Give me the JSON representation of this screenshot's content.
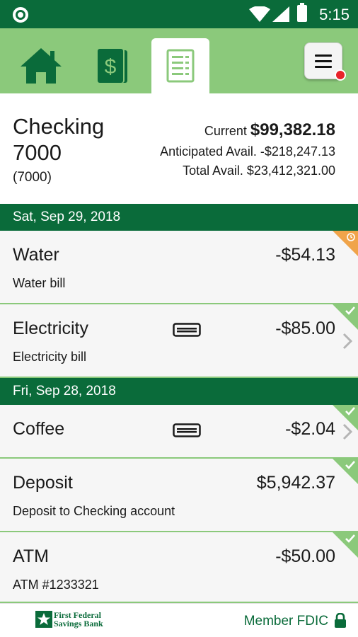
{
  "status_bar": {
    "time": "5:15"
  },
  "nav": {
    "tabs": [
      {
        "name": "home",
        "icon": "home-icon"
      },
      {
        "name": "accounts",
        "icon": "dollar-icon"
      },
      {
        "name": "register",
        "icon": "register-icon",
        "active": true
      }
    ],
    "menu_icon": "hamburger-icon"
  },
  "account": {
    "name": "Checking 7000",
    "number": "(7000)",
    "current_label": "Current",
    "current_amount": "$99,382.18",
    "anticipated_label": "Anticipated Avail.",
    "anticipated_amount": "-$218,247.13",
    "total_label": "Total Avail.",
    "total_amount": "$23,412,321.00"
  },
  "groups": [
    {
      "date": "Sat, Sep 29, 2018",
      "transactions": [
        {
          "title": "Water",
          "description": "Water bill",
          "amount": "-$54.13",
          "status": "pending"
        },
        {
          "title": "Electricity",
          "description": "Electricity bill",
          "amount": "-$85.00",
          "status": "cleared",
          "card": true
        }
      ]
    },
    {
      "date": "Fri, Sep 28, 2018",
      "transactions": [
        {
          "title": "Coffee",
          "description": "",
          "amount": "-$2.04",
          "status": "cleared",
          "card": true
        },
        {
          "title": "Deposit",
          "description": "Deposit to Checking account",
          "amount": "$5,942.37",
          "status": "cleared"
        },
        {
          "title": "ATM",
          "description": "ATM #1233321",
          "amount": "-$50.00",
          "status": "cleared"
        }
      ]
    }
  ],
  "footer": {
    "logo_line1": "First Federal",
    "logo_line2": "Savings Bank",
    "fdic": "Member FDIC"
  },
  "colors": {
    "dark_green": "#0a6b3a",
    "light_green": "#8bc97b",
    "pending_orange": "#f0a44a",
    "badge_red": "#e8232a"
  }
}
